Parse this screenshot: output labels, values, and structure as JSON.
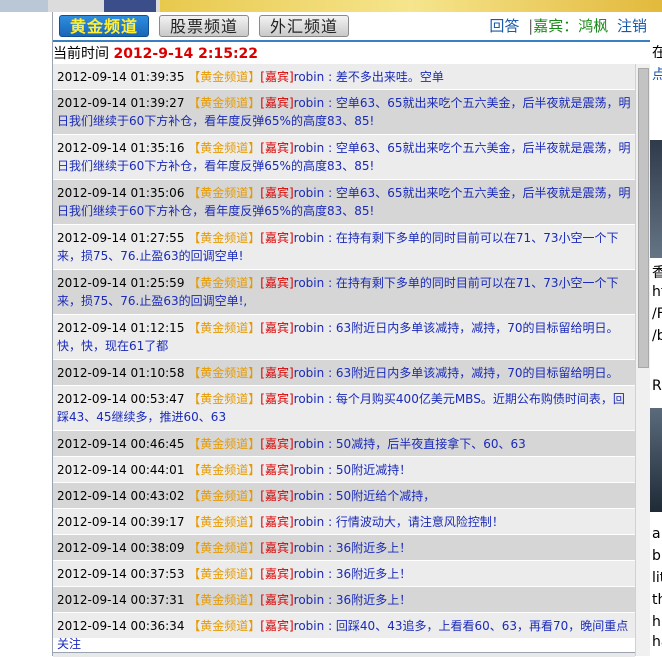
{
  "nav": {
    "tabs": [
      "黄金频道",
      "股票频道",
      "外汇频道"
    ],
    "reply": "回答",
    "separator": "|",
    "guest": "嘉宾：鸿枫",
    "logout": "注销"
  },
  "status": {
    "time_label": "当前时间",
    "time_value": "2012-9-14 2:15:22"
  },
  "messages": [
    {
      "time": "2012-09-14 01:39:35",
      "channel": "【黄金频道】",
      "role": "[嘉宾]",
      "user": "robin",
      "text": "差不多出来哇。空单"
    },
    {
      "time": "2012-09-14 01:39:27",
      "channel": "【黄金频道】",
      "role": "[嘉宾]",
      "user": "robin",
      "text": "空单63、65就出来吃个五六美金，后半夜就是震荡，明日我们继续于60下方补仓，看年度反弹65%的高度83、85!"
    },
    {
      "time": "2012-09-14 01:35:16",
      "channel": "【黄金频道】",
      "role": "[嘉宾]",
      "user": "robin",
      "text": "空单63、65就出来吃个五六美金，后半夜就是震荡，明日我们继续于60下方补仓，看年度反弹65%的高度83、85!"
    },
    {
      "time": "2012-09-14 01:35:06",
      "channel": "【黄金频道】",
      "role": "[嘉宾]",
      "user": "robin",
      "text": "空单63、65就出来吃个五六美金，后半夜就是震荡，明日我们继续于60下方补仓，看年度反弹65%的高度83、85!"
    },
    {
      "time": "2012-09-14 01:27:55",
      "channel": "【黄金频道】",
      "role": "[嘉宾]",
      "user": "robin",
      "text": "在持有剩下多单的同时目前可以在71、73小空一个下来，损75、76.止盈63的回调空单!"
    },
    {
      "time": "2012-09-14 01:25:59",
      "channel": "【黄金频道】",
      "role": "[嘉宾]",
      "user": "robin",
      "text": "在持有剩下多单的同时目前可以在71、73小空一个下来，损75、76.止盈63的回调空单!,"
    },
    {
      "time": "2012-09-14 01:12:15",
      "channel": "【黄金频道】",
      "role": "[嘉宾]",
      "user": "robin",
      "text": "63附近日内多单该减持，减持，70的目标留给明日。快，快，现在61了都"
    },
    {
      "time": "2012-09-14 01:10:58",
      "channel": "【黄金频道】",
      "role": "[嘉宾]",
      "user": "robin",
      "text": "63附近日内多单该减持，减持，70的目标留给明日。"
    },
    {
      "time": "2012-09-14 00:53:47",
      "channel": "【黄金频道】",
      "role": "[嘉宾]",
      "user": "robin",
      "text": "每个月购买400亿美元MBS。近期公布购债时间表，回踩43、45继续多，推进60、63"
    },
    {
      "time": "2012-09-14 00:46:45",
      "channel": "【黄金频道】",
      "role": "[嘉宾]",
      "user": "robin",
      "text": "50减持，后半夜直接拿下、60、63"
    },
    {
      "time": "2012-09-14 00:44:01",
      "channel": "【黄金频道】",
      "role": "[嘉宾]",
      "user": "robin",
      "text": "50附近减持！"
    },
    {
      "time": "2012-09-14 00:43:02",
      "channel": "【黄金频道】",
      "role": "[嘉宾]",
      "user": "robin",
      "text": "50附近给个减持，"
    },
    {
      "time": "2012-09-14 00:39:17",
      "channel": "【黄金频道】",
      "role": "[嘉宾]",
      "user": "robin",
      "text": "行情波动大，请注意风险控制！"
    },
    {
      "time": "2012-09-14 00:38:09",
      "channel": "【黄金频道】",
      "role": "[嘉宾]",
      "user": "robin",
      "text": "36附近多上！"
    },
    {
      "time": "2012-09-14 00:37:53",
      "channel": "【黄金频道】",
      "role": "[嘉宾]",
      "user": "robin",
      "text": "36附近多上！"
    },
    {
      "time": "2012-09-14 00:37:31",
      "channel": "【黄金频道】",
      "role": "[嘉宾]",
      "user": "robin",
      "text": "36附近多上！"
    },
    {
      "time": "2012-09-14 00:36:34",
      "channel": "【黄金频道】",
      "role": "[嘉宾]",
      "user": "robin",
      "text": "回踩40、43追多，上看看60、63，再看70，晚间重点关注"
    }
  ],
  "right_partial": {
    "line1": "在",
    "line2": "点",
    "line3": "香",
    "line4": "ht",
    "line5": "/F",
    "line6": "/b",
    "line7": "R",
    "line8": "a",
    "line9": "b",
    "line10": "lit",
    "line11": "th",
    "line12": "h",
    "line13": "ha",
    "line14": "p"
  }
}
